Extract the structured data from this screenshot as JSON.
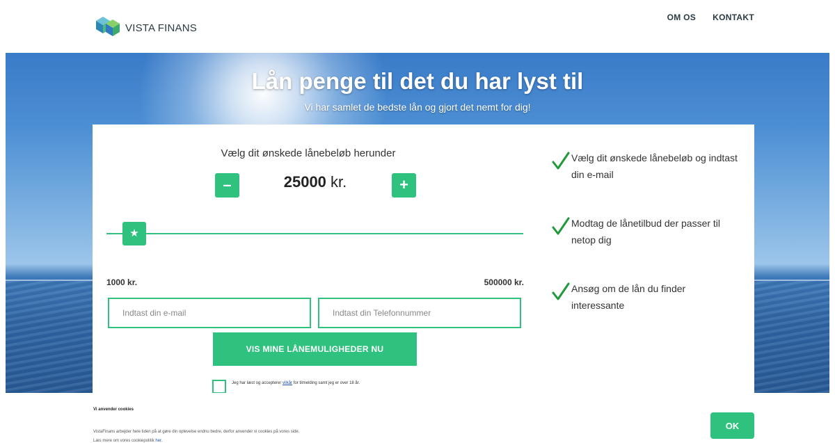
{
  "header": {
    "logo_text": "VISTA FINANS",
    "nav": [
      "OM OS",
      "KONTAKT"
    ]
  },
  "hero": {
    "title": "Lån penge til det du har lyst til",
    "subtitle": "Vi har samlet de bedste lån og gjort det nemt for dig!"
  },
  "calculator": {
    "label": "Vælg dit ønskede lånebeløb herunder",
    "amount_value": "25000",
    "amount_unit": " kr.",
    "minus_symbol": "–",
    "plus_symbol": "+",
    "slider_min": "1000 kr.",
    "slider_max": "500000 kr.",
    "slider_fraction": 0.048,
    "email_placeholder": "Indtast din e-mail",
    "phone_placeholder": "Indtast din Telefonnummer",
    "submit_label": "VIS MINE LÅNEMULIGHEDER NU",
    "terms_before": "Jeg har læst og accepterer ",
    "terms_link": "vilkår",
    "terms_after": " for tilmelding samt jeg er over 18 år."
  },
  "steps": [
    {
      "text": "Vælg dit ønskede lånebeløb og indtast din e-mail"
    },
    {
      "text": "Modtag de lånetilbud der passer til netop dig"
    },
    {
      "text": "Ansøg om de lån du finder interessante"
    }
  ],
  "cookie": {
    "title": "Vi anvender cookies",
    "text": "VistaFinans arbejder hele tiden på at gøre din oplevelse endnu bedre, derfor anvender vi cookies på vores side.",
    "more_text": "Læs mere om vores cookiepolitik ",
    "more_link": "her.",
    "ok_label": "OK"
  },
  "colors": {
    "accent": "#2ec27e",
    "link": "#1a4fa0",
    "text": "#333333"
  }
}
